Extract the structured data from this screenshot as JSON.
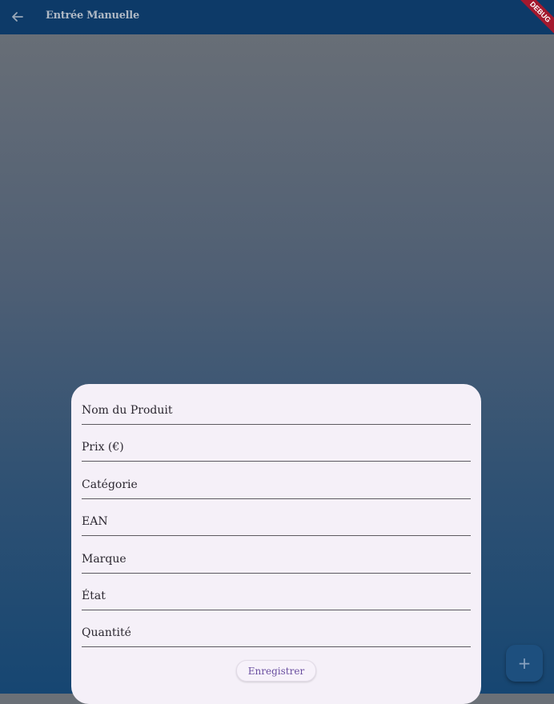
{
  "app_bar": {
    "title": "Entrée Manuelle",
    "back_icon": "arrow-back-icon",
    "debug_banner": "DEBUG"
  },
  "form": {
    "fields": [
      {
        "label": "Nom du Produit"
      },
      {
        "label": "Prix (€)"
      },
      {
        "label": "Catégorie"
      },
      {
        "label": "EAN"
      },
      {
        "label": "Marque"
      },
      {
        "label": "État"
      },
      {
        "label": "Quantité"
      }
    ],
    "save_label": "Enregistrer"
  },
  "fab": {
    "icon": "plus-icon",
    "label": "+"
  },
  "colors": {
    "app_bar": "#0d3a68",
    "card": "#f5f0f8",
    "accent": "#6a4fa0",
    "debug": "#a3192e"
  }
}
